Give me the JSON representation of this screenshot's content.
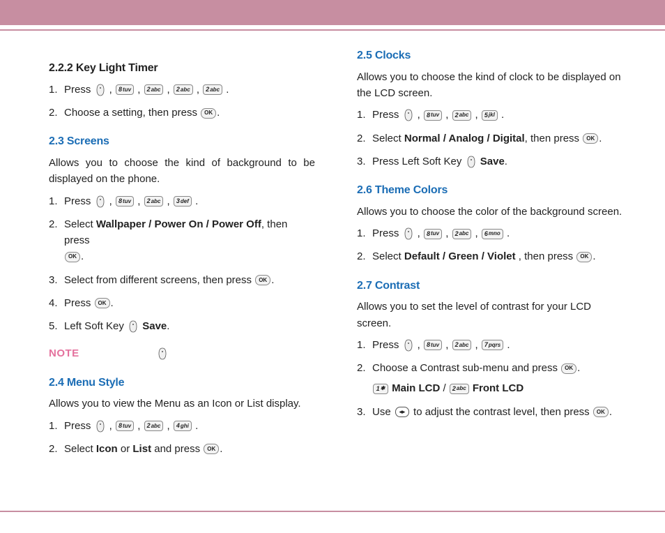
{
  "left": {
    "s222": {
      "title": "2.2.2 Key Light Timer",
      "step1": "Press",
      "step2a": "Choose a setting, then press",
      "step2b": "."
    },
    "s23": {
      "title": "2.3 Screens",
      "desc": "Allows you to choose the kind of background to be displayed on the phone.",
      "step1": "Press",
      "step2a": "Select ",
      "step2opts": "Wallpaper / Power On / Power Off",
      "step2b": ", then press",
      "step2c": ".",
      "step3a": "Select from different screens, then press",
      "step3b": ".",
      "step4a": "Press",
      "step4b": ".",
      "step5a": "Left Soft Key",
      "step5b": "Save",
      "step5c": "."
    },
    "note": "NOTE",
    "s24": {
      "title": "2.4 Menu Style",
      "desc": "Allows you to view the Menu as an Icon or List display.",
      "step1": "Press",
      "step2a": "Select ",
      "step2opts": "Icon",
      "step2mid": " or ",
      "step2opts2": "List",
      "step2b": " and press",
      "step2c": "."
    }
  },
  "right": {
    "s25": {
      "title": "2.5 Clocks",
      "desc": "Allows you to choose the kind of clock to be displayed on the LCD screen.",
      "step1": "Press",
      "step2a": "Select ",
      "step2opts": "Normal / Analog / Digital",
      "step2b": ", then press",
      "step2c": ".",
      "step3a": "Press Left Soft Key",
      "step3b": "Save",
      "step3c": "."
    },
    "s26": {
      "title": "2.6 Theme Colors",
      "desc": "Allows you to choose the color of the background screen.",
      "step1": "Press",
      "step2a": "Select ",
      "step2opts": "Default / Green / Violet",
      "step2b": " , then press",
      "step2c": "."
    },
    "s27": {
      "title": "2.7 Contrast",
      "desc": "Allows you to set the level of contrast for your LCD screen.",
      "step1": "Press",
      "step2a": "Choose a Contrast sub-menu and press",
      "step2b": ".",
      "subA": "Main LCD",
      "subMid": " / ",
      "subB": "Front LCD",
      "step3a": "Use",
      "step3b": "to adjust the contrast level, then press",
      "step3c": "."
    }
  },
  "keys": {
    "k1": "1",
    "k2": "2",
    "k3": "3",
    "k4": "4",
    "k5": "5",
    "k6": "6",
    "k7": "7",
    "k8": "8",
    "abc": "abc",
    "def": "def",
    "ghi": "ghi",
    "jkl": "jkl",
    "mno": "mno",
    "pqrs": "pqrs",
    "tuv": "tuv",
    "ok": "OK",
    "sym": "✱"
  }
}
